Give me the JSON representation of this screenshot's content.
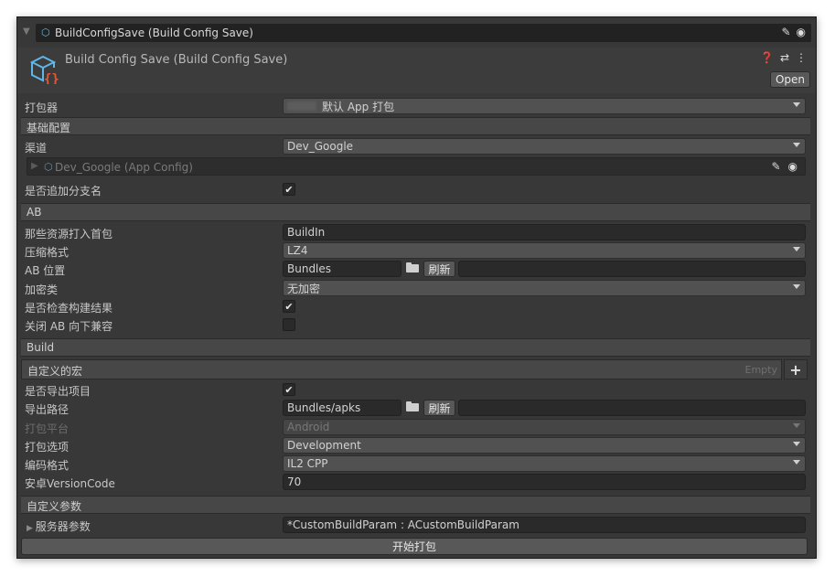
{
  "titlebar": {
    "title": "BuildConfigSave (Build Config Save)",
    "icons": [
      "pencil-icon",
      "target-icon"
    ]
  },
  "header": {
    "title": "Build Config Save (Build Config Save)",
    "icons": [
      "help-icon",
      "preset-icon",
      "menu-dots-icon"
    ],
    "open_label": "Open"
  },
  "packer": {
    "label": "打包器",
    "value": "默认 App 打包"
  },
  "sections": {
    "basic": "基础配置",
    "ab": "AB",
    "build": "Build",
    "custom_params": "自定义参数"
  },
  "basic": {
    "channel_label": "渠道",
    "channel_value": "Dev_Google",
    "channel_ref": "Dev_Google (App Config)",
    "append_branch_label": "是否追加分支名",
    "append_branch_checked": true
  },
  "ab": {
    "first_pack_label": "那些资源打入首包",
    "first_pack_value": "BuildIn",
    "compress_label": "压缩格式",
    "compress_value": "LZ4",
    "location_label": "AB 位置",
    "location_value": "Bundles",
    "refresh_label": "刷新",
    "encrypt_label": "加密类",
    "encrypt_value": "无加密",
    "check_build_label": "是否检查构建结果",
    "check_build_checked": true,
    "disable_compat_label": "关闭 AB 向下兼容",
    "disable_compat_checked": false
  },
  "build": {
    "macro_label": "自定义的宏",
    "macro_empty": "Empty",
    "export_project_label": "是否导出项目",
    "export_project_checked": true,
    "export_path_label": "导出路径",
    "export_path_value": "Bundles/apks",
    "refresh_label": "刷新",
    "platform_label": "打包平台",
    "platform_value": "Android",
    "options_label": "打包选项",
    "options_value": "Development",
    "encoding_label": "编码格式",
    "encoding_value": "IL2 CPP",
    "version_code_label": "安卓VersionCode",
    "version_code_value": "70"
  },
  "custom": {
    "server_params_label": "服务器参数",
    "server_params_value": "*CustomBuildParam : ACustomBuildParam"
  },
  "start_button": "开始打包",
  "colors": {
    "window_bg": "#383838",
    "section_bg": "#474747",
    "field_bg": "#2a2a2a",
    "dropdown_bg": "#515151",
    "icon_accent": "#5fb6e8",
    "icon_secondary": "#e05a3a"
  }
}
